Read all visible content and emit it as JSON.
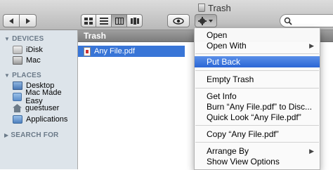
{
  "window": {
    "title": "Trash"
  },
  "toolbar": {
    "back_icon": "back-arrow-icon",
    "forward_icon": "forward-arrow-icon",
    "view_icons": [
      "icon-view-icon",
      "list-view-icon",
      "column-view-icon",
      "coverflow-view-icon"
    ],
    "quicklook_icon": "eye-icon",
    "action_icon": "gear-icon",
    "search_icon": "search-icon"
  },
  "sidebar": {
    "devices_header": "DEVICES",
    "devices": [
      {
        "label": "iDisk",
        "icon": "idisk-icon"
      },
      {
        "label": "Mac",
        "icon": "mac-icon"
      }
    ],
    "places_header": "PLACES",
    "places": [
      {
        "label": "Desktop",
        "icon": "desktop-icon"
      },
      {
        "label": "Mac Made Easy",
        "icon": "folder-icon"
      },
      {
        "label": "guestuser",
        "icon": "home-icon"
      },
      {
        "label": "Applications",
        "icon": "applications-icon"
      }
    ],
    "search_header": "SEARCH FOR"
  },
  "file_list": {
    "header": "Trash",
    "files": [
      {
        "name": "Any File.pdf",
        "selected": true
      }
    ]
  },
  "context_menu": {
    "items": [
      {
        "label": "Open"
      },
      {
        "label": "Open With",
        "submenu": true
      },
      {
        "label": "Put Back",
        "highlighted": true
      },
      {
        "label": "Empty Trash"
      },
      {
        "label": "Get Info"
      },
      {
        "label": "Burn “Any File.pdf” to Disc..."
      },
      {
        "label": "Quick Look “Any File.pdf”"
      },
      {
        "label": "Copy “Any File.pdf”"
      },
      {
        "label": "Arrange By",
        "submenu": true
      },
      {
        "label": "Show View Options"
      }
    ]
  },
  "colors": {
    "selection": "#3875d7",
    "menu_highlight": "#2a66d5",
    "sidebar_bg": "#dde4ea"
  }
}
